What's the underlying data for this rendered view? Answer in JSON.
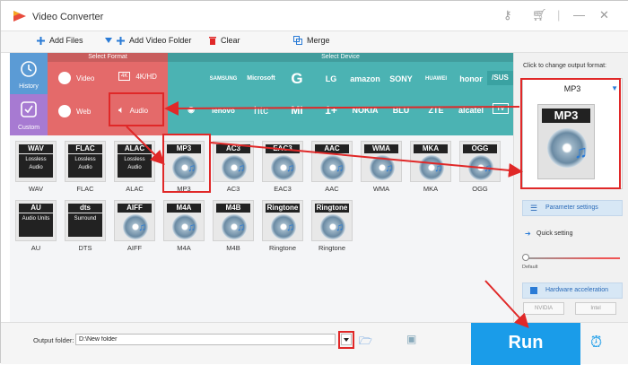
{
  "window": {
    "title": "Video Converter"
  },
  "toolbar": {
    "add_files": "Add Files",
    "add_video_folder": "Add Video Folder",
    "clear": "Clear",
    "merge": "Merge"
  },
  "sidebar": {
    "history": "History",
    "custom": "Custom"
  },
  "select_format": {
    "header": "Select Format",
    "video": "Video",
    "k4": "4K/HD",
    "web": "Web",
    "audio": "Audio"
  },
  "select_device": {
    "header": "Select Device",
    "row1": [
      "SAMSUNG",
      "Microsoft",
      "G",
      "LG",
      "amazon",
      "SONY",
      "HUAWEI",
      "honor",
      "/SUS"
    ],
    "row2": [
      "lenovo",
      "htc",
      "MI",
      "1+",
      "NOKIA",
      "BLU",
      "ZTE",
      "alcatel",
      "TV"
    ]
  },
  "formats": [
    {
      "cap": "WAV",
      "sub": "Lossless Audio",
      "label": "WAV"
    },
    {
      "cap": "FLAC",
      "sub": "Lossless Audio",
      "label": "FLAC"
    },
    {
      "cap": "ALAC",
      "sub": "Lossless Audio",
      "label": "ALAC"
    },
    {
      "cap": "MP3",
      "sub": "",
      "label": "MP3"
    },
    {
      "cap": "AC3",
      "sub": "",
      "label": "AC3"
    },
    {
      "cap": "EAC3",
      "sub": "",
      "label": "EAC3"
    },
    {
      "cap": "AAC",
      "sub": "",
      "label": "AAC"
    },
    {
      "cap": "WMA",
      "sub": "",
      "label": "WMA"
    },
    {
      "cap": "MKA",
      "sub": "",
      "label": "MKA"
    },
    {
      "cap": "OGG",
      "sub": "",
      "label": "OGG"
    },
    {
      "cap": "AU",
      "sub": "Audio Units",
      "label": "AU"
    },
    {
      "cap": "dts",
      "sub": "Surround",
      "label": "DTS"
    },
    {
      "cap": "AIFF",
      "sub": "",
      "label": "AIFF"
    },
    {
      "cap": "M4A",
      "sub": "",
      "label": "M4A"
    },
    {
      "cap": "M4B",
      "sub": "",
      "label": "M4B"
    },
    {
      "cap": "Ringtone",
      "sub": "",
      "label": "Ringtone"
    },
    {
      "cap": "Ringtone",
      "sub": "",
      "label": "Ringtone"
    }
  ],
  "output": {
    "hint": "Click to change output format:",
    "format_name": "MP3",
    "format_cap": "MP3"
  },
  "settings": {
    "parameter": "Parameter settings",
    "quick": "Quick setting",
    "default": "Default",
    "hw_accel": "Hardware acceleration",
    "nvidia": "NVIDIA",
    "intel": "Intel"
  },
  "bottom": {
    "output_folder_label": "Output folder:",
    "output_folder_value": "D:\\New folder",
    "run": "Run"
  },
  "colors": {
    "format_red": "#e46a6a",
    "device_teal": "#4bb3b3",
    "history_blue": "#5b9bd5",
    "custom_purple": "#a77ad2",
    "run_blue": "#1a9ce9",
    "highlight_red": "#e02828"
  }
}
